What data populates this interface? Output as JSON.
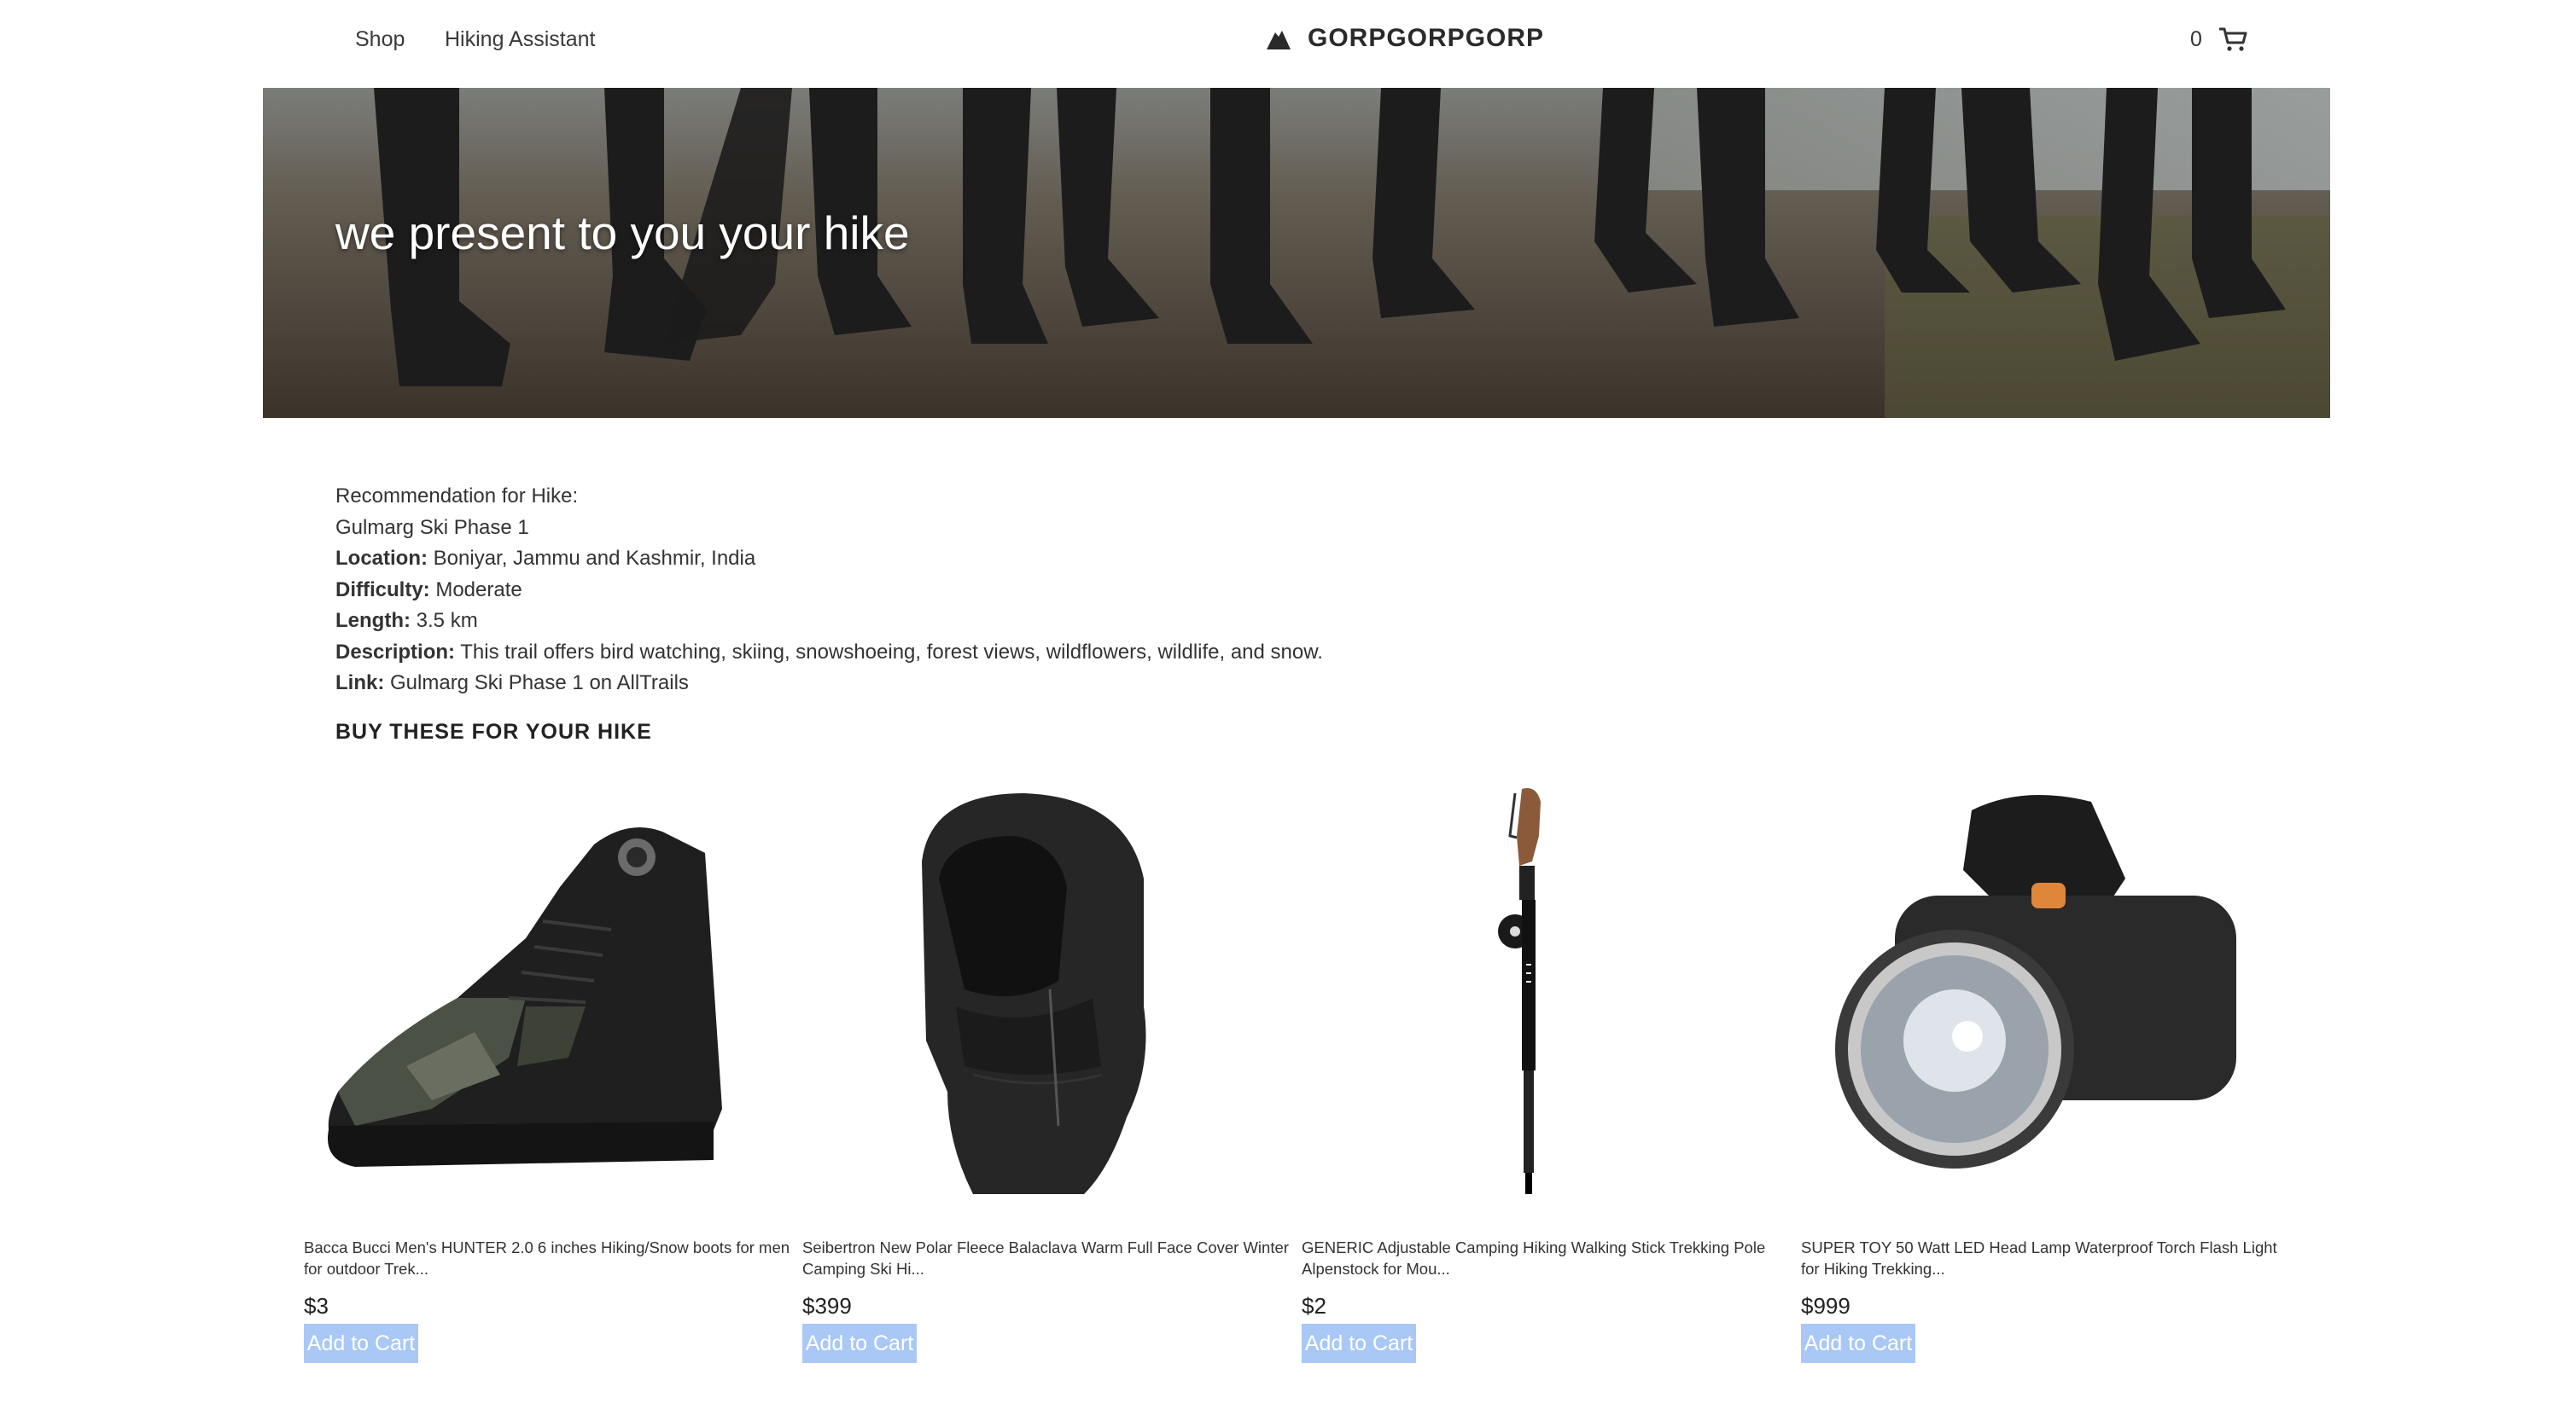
{
  "nav": {
    "links": [
      "Shop",
      "Hiking Assistant"
    ],
    "brand": "GORPGORPGORP",
    "cart_count": "0"
  },
  "hero": {
    "title": "we present to you your hike"
  },
  "recommendation": {
    "heading": "Recommendation for Hike:",
    "trail_name": "Gulmarg Ski Phase 1",
    "location_label": "Location:",
    "location": "Boniyar, Jammu and Kashmir, India",
    "difficulty_label": "Difficulty:",
    "difficulty": "Moderate",
    "length_label": "Length:",
    "length": "3.5 km",
    "description_label": "Description:",
    "description": "This trail offers bird watching, skiing, snowshoeing, forest views, wildflowers, wildlife, and snow.",
    "link_label": "Link:",
    "link_text": "Gulmarg Ski Phase 1 on AllTrails"
  },
  "buy_heading": "BUY THESE FOR YOUR HIKE",
  "products": [
    {
      "title": "Bacca Bucci Men's HUNTER 2.0 6 inches Hiking/Snow boots for men for outdoor Trek...",
      "price": "$3",
      "button": "Add to Cart",
      "image": "hiking-boot"
    },
    {
      "title": "Seibertron New Polar Fleece Balaclava Warm Full Face Cover Winter Camping Ski Hi...",
      "price": "$399",
      "button": "Add to Cart",
      "image": "balaclava"
    },
    {
      "title": "GENERIC Adjustable Camping Hiking Walking Stick Trekking Pole Alpenstock for Mou...",
      "price": "$2",
      "button": "Add to Cart",
      "image": "trekking-pole"
    },
    {
      "title": "SUPER TOY 50 Watt LED Head Lamp Waterproof Torch Flash Light for Hiking Trekking...",
      "price": "$999",
      "button": "Add to Cart",
      "image": "head-lamp"
    }
  ],
  "colors": {
    "button_bg": "#a9c8f5",
    "brand_text": "#2a2a2a"
  }
}
